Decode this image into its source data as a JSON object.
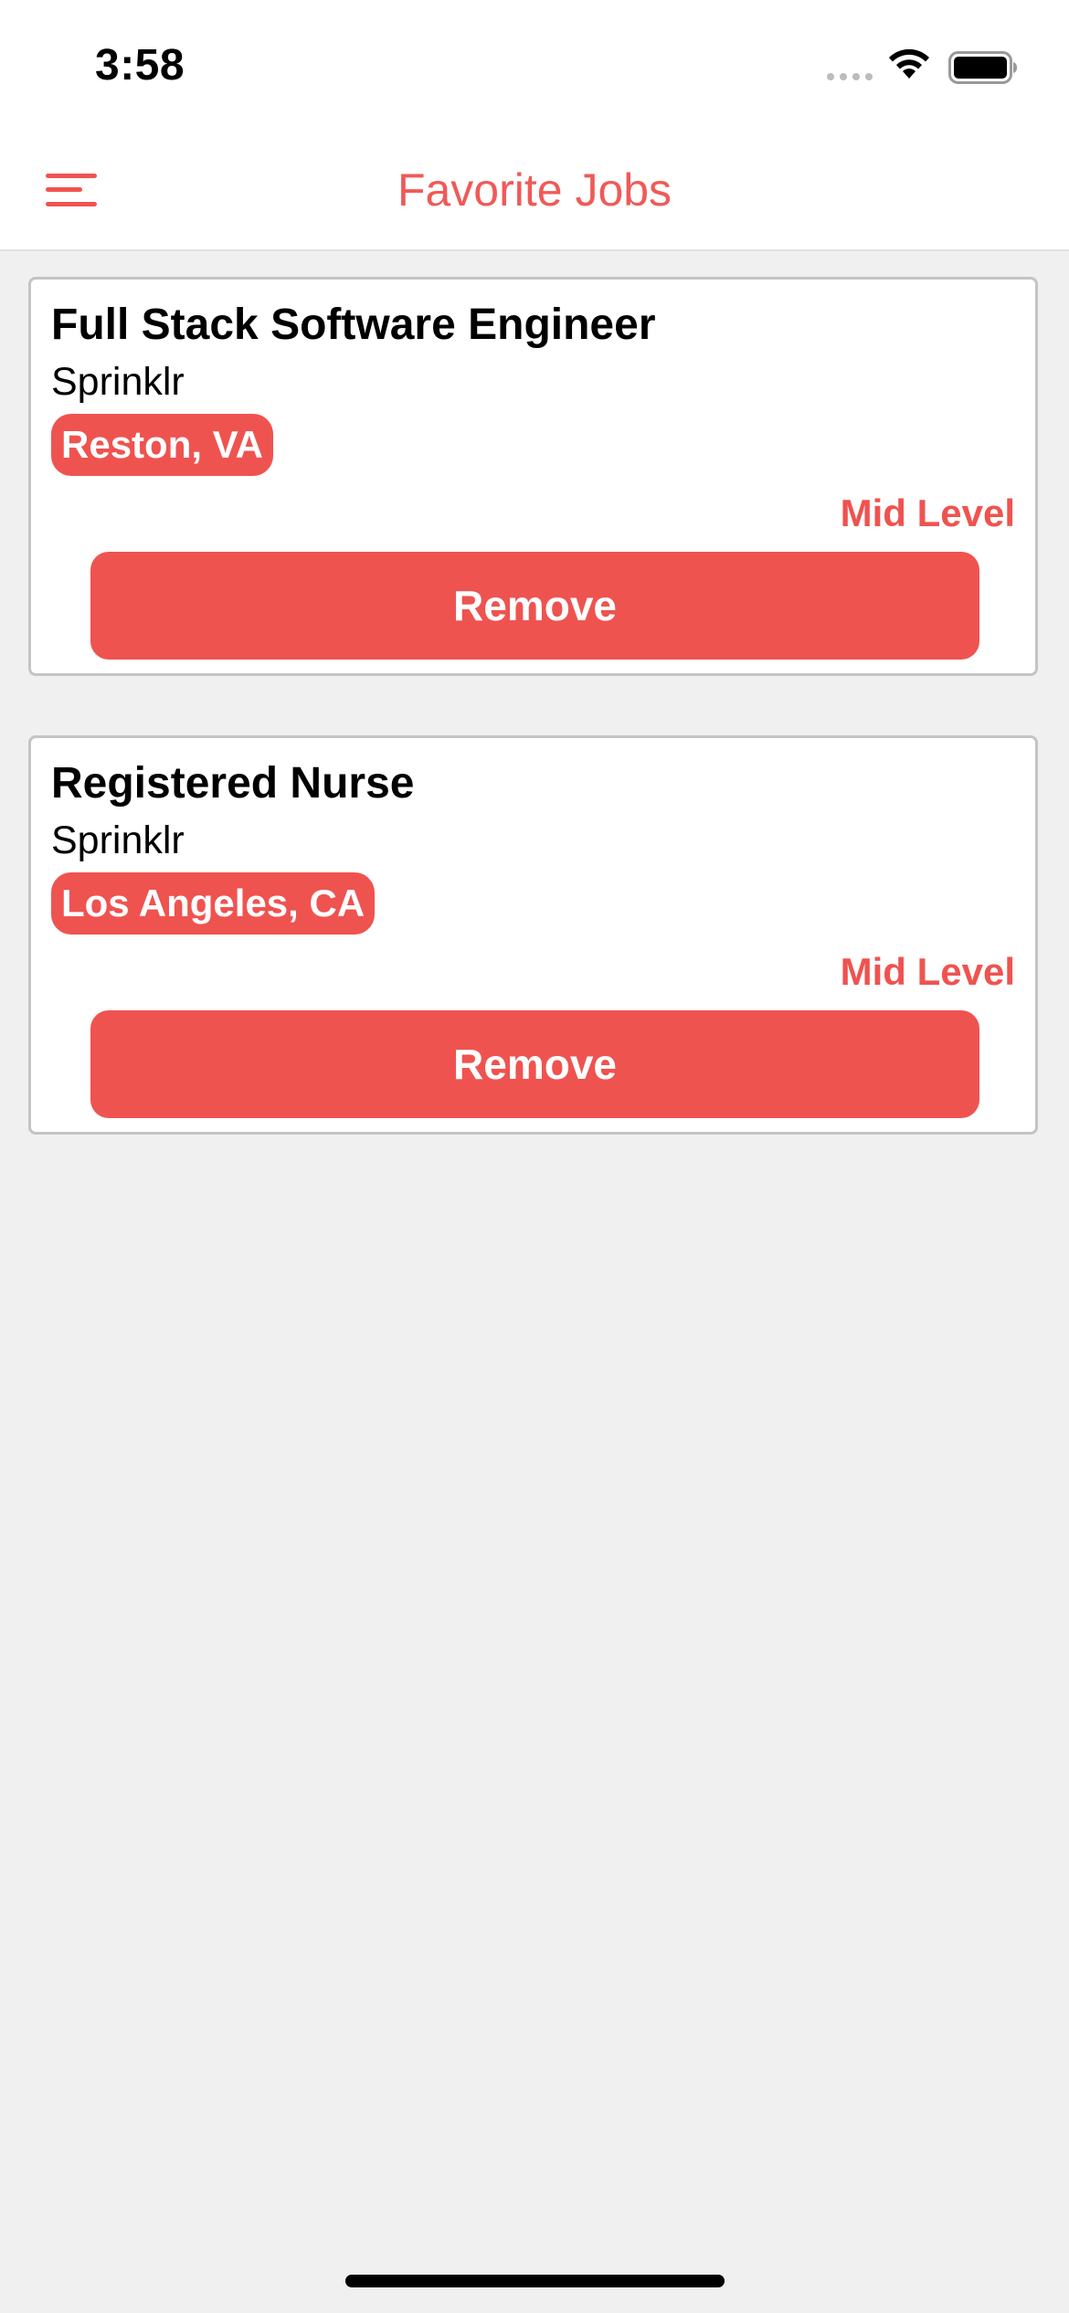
{
  "status_bar": {
    "time": "3:58",
    "signal_icon": "signal-dots-icon",
    "wifi_icon": "wifi-icon",
    "battery_icon": "battery-icon"
  },
  "nav": {
    "title": "Favorite Jobs",
    "menu_icon": "hamburger-menu-icon"
  },
  "jobs": [
    {
      "title": "Full Stack Software Engineer",
      "company": "Sprinklr",
      "location": "Reston, VA",
      "level": "Mid Level",
      "remove_label": "Remove"
    },
    {
      "title": "Registered Nurse",
      "company": "Sprinklr",
      "location": "Los Angeles, CA",
      "level": "Mid Level",
      "remove_label": "Remove"
    }
  ],
  "colors": {
    "accent": "#ef5350",
    "background": "#f0f0f0",
    "card": "#ffffff"
  }
}
